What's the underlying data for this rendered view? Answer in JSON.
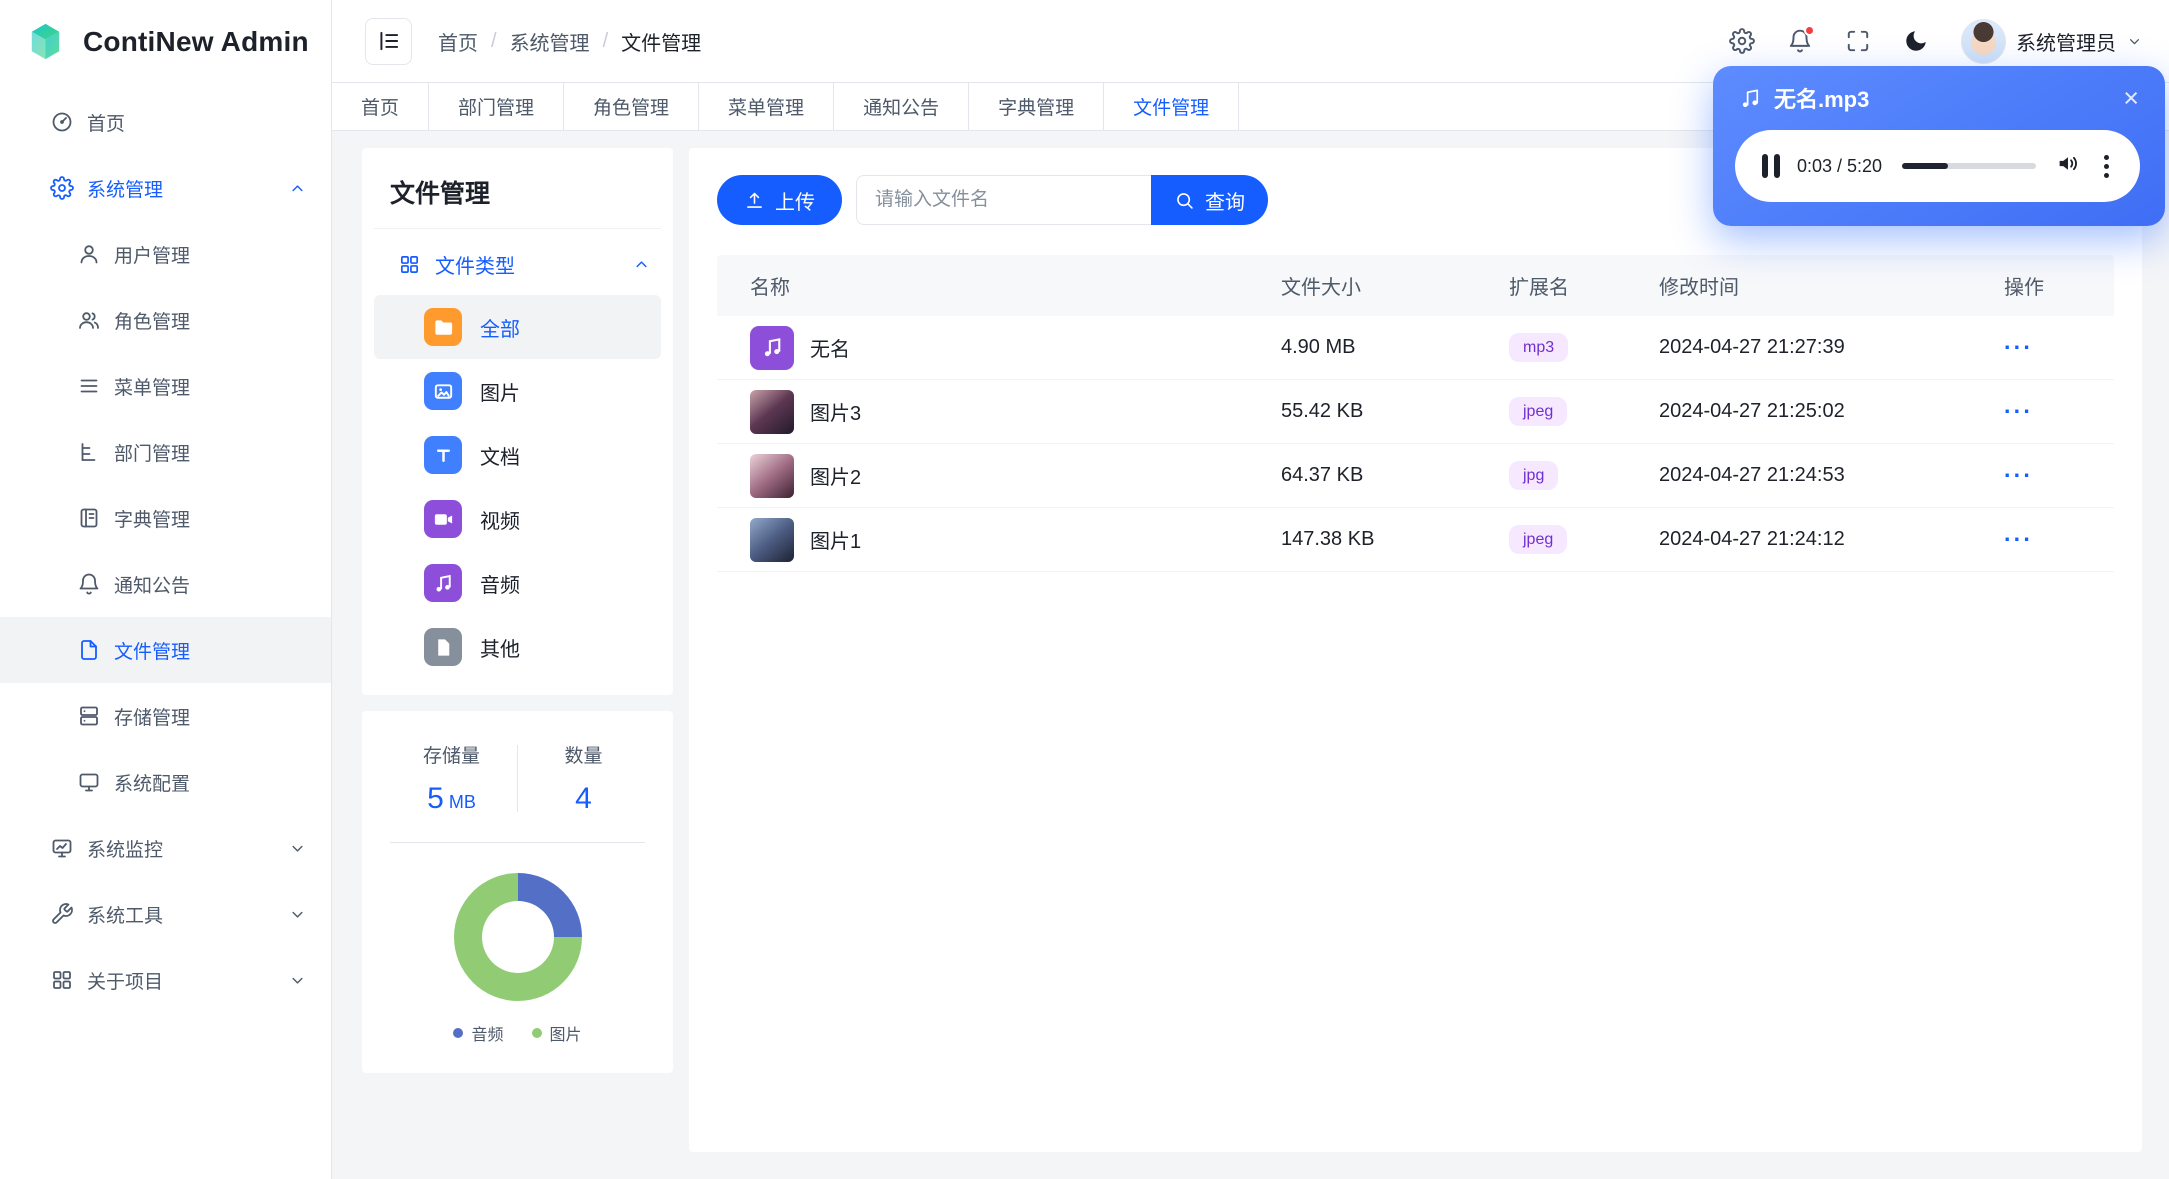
{
  "app": {
    "name": "ContiNew Admin"
  },
  "theme": {
    "primary": "#165DFF",
    "tag_bg": "#F5E8FF",
    "tag_text": "#722ED1",
    "notification_dot": "#F53F3F"
  },
  "header": {
    "breadcrumb": [
      "首页",
      "系统管理",
      "文件管理"
    ],
    "breadcrumb_separator": "/",
    "user_name": "系统管理员"
  },
  "tabs": {
    "items": [
      {
        "label": "首页",
        "active": false
      },
      {
        "label": "部门管理",
        "active": false
      },
      {
        "label": "角色管理",
        "active": false
      },
      {
        "label": "菜单管理",
        "active": false
      },
      {
        "label": "通知公告",
        "active": false
      },
      {
        "label": "字典管理",
        "active": false
      },
      {
        "label": "文件管理",
        "active": true
      }
    ]
  },
  "sidebar": {
    "items": [
      {
        "label": "首页",
        "icon": "dashboard",
        "level": 1
      },
      {
        "label": "系统管理",
        "icon": "settings",
        "level": 1,
        "active": true,
        "chevron": "up"
      },
      {
        "label": "用户管理",
        "icon": "user",
        "level": 2
      },
      {
        "label": "角色管理",
        "icon": "users",
        "level": 2
      },
      {
        "label": "菜单管理",
        "icon": "menu",
        "level": 2
      },
      {
        "label": "部门管理",
        "icon": "tree",
        "level": 2
      },
      {
        "label": "字典管理",
        "icon": "book",
        "level": 2
      },
      {
        "label": "通知公告",
        "icon": "bell",
        "level": 2
      },
      {
        "label": "文件管理",
        "icon": "file",
        "level": 2,
        "selected": true
      },
      {
        "label": "存储管理",
        "icon": "storage",
        "level": 2
      },
      {
        "label": "系统配置",
        "icon": "monitor",
        "level": 2
      },
      {
        "label": "系统监控",
        "icon": "monitor-chart",
        "level": 1,
        "chevron": "down"
      },
      {
        "label": "系统工具",
        "icon": "tool",
        "level": 1,
        "chevron": "down"
      },
      {
        "label": "关于项目",
        "icon": "apps",
        "level": 1,
        "chevron": "down"
      }
    ]
  },
  "file_panel": {
    "title": "文件管理",
    "group_label": "文件类型",
    "types": [
      {
        "label": "全部",
        "icon": "folder-f",
        "color": "#FF9A2E",
        "active": true
      },
      {
        "label": "图片",
        "icon": "image-f",
        "color": "#4080FF",
        "active": false
      },
      {
        "label": "文档",
        "icon": "doc-f",
        "color": "#4080FF",
        "active": false
      },
      {
        "label": "视频",
        "icon": "video-f",
        "color": "#8D4EDA",
        "active": false
      },
      {
        "label": "音频",
        "icon": "audio-f",
        "color": "#8D4EDA",
        "active": false
      },
      {
        "label": "其他",
        "icon": "file-f",
        "color": "#86909C",
        "active": false
      }
    ],
    "stats": {
      "storage_label": "存储量",
      "storage_value": "5",
      "storage_unit": "MB",
      "count_label": "数量",
      "count_value": "4"
    }
  },
  "chart_data": {
    "type": "pie",
    "labels": [
      "音频",
      "图片"
    ],
    "values": [
      1,
      3
    ],
    "colors": [
      "#5470C6",
      "#91CC75"
    ],
    "legend_position": "bottom",
    "donut": true
  },
  "toolbar": {
    "upload_label": "上传",
    "search_placeholder": "请输入文件名",
    "search_value": "",
    "query_label": "查询"
  },
  "table": {
    "columns": [
      "名称",
      "文件大小",
      "扩展名",
      "修改时间",
      "操作"
    ],
    "row_action_label": "···",
    "rows": [
      {
        "name": "无名",
        "kind": "audio",
        "size": "4.90 MB",
        "ext": "mp3",
        "modified": "2024-04-27 21:27:39"
      },
      {
        "name": "图片3",
        "kind": "image",
        "size": "55.42 KB",
        "ext": "jpeg",
        "modified": "2024-04-27 21:25:02"
      },
      {
        "name": "图片2",
        "kind": "image",
        "size": "64.37 KB",
        "ext": "jpg",
        "modified": "2024-04-27 21:24:53"
      },
      {
        "name": "图片1",
        "kind": "image",
        "size": "147.38 KB",
        "ext": "jpeg",
        "modified": "2024-04-27 21:24:12"
      }
    ]
  },
  "player": {
    "title": "无名.mp3",
    "time_current": "0:03",
    "time_total": "5:20",
    "time_display": "0:03 / 5:20",
    "progress_percent": 34
  }
}
